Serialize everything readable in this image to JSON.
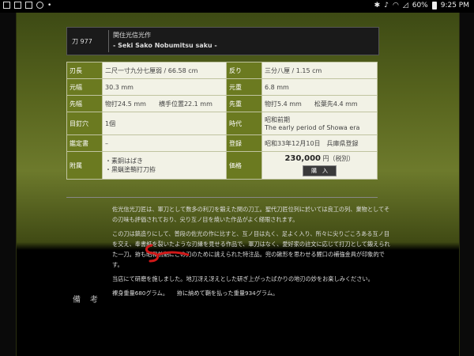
{
  "status": {
    "battery": "60%",
    "time": "9:25 PM"
  },
  "header": {
    "item_no": "刀 977",
    "title_jp": "関住光信光作",
    "title_en": "- Seki Sako Nobumitsu saku -"
  },
  "spec": [
    {
      "k1": "刃長",
      "v1": "二尺一寸九分七厘弱 / 66.58 cm",
      "k2": "反り",
      "v2": "三分八厘 / 1.15 cm"
    },
    {
      "k1": "元幅",
      "v1": "30.3 mm",
      "k2": "元重",
      "v2": "6.8 mm"
    },
    {
      "k1": "先幅",
      "v1": "物打24.5 mm　　横手位置22.1 mm",
      "k2": "先重",
      "v2": "物打5.4 mm　　松葉先4.4 mm"
    },
    {
      "k1": "目釘穴",
      "v1": "1個",
      "k2": "時代",
      "v2": "昭和前期",
      "v2b": "The early period of Showa era"
    },
    {
      "k1": "鑑定書",
      "v1": "–",
      "k2": "登録",
      "v2": "昭和33年12月10日　兵庫県登録"
    }
  ],
  "accessories": {
    "key": "附属",
    "items": [
      "・素銅はばき",
      "・黒蝋塗鞘打刀拵"
    ],
    "price_key": "価格",
    "price": "230,000",
    "price_unit": "円（税別）",
    "buy_label": "購　入"
  },
  "notes_label": "備考",
  "notes": [
    "佐光信光刀匠は、軍刀として数多の利刀を鍛えた関の刀工。聖代刀匠位列に於いては良工の列、業物としてその刃味も評価されており、尖り互ノ目を焼いた作品がよく経眼されます。",
    "この刀は鎬造りにして、普段の佐光の作に比すと、互ノ目は丸く、足よく入り、所々に尖りごころある互ノ目を交え、奉書紙を裂いたような刃縁を見せる作品で、軍刀はなく、愛好家の註文に応じて打刀として鍛えられた一刀。拵も昭和前期にこの刀のために誂えられた特注品。兜の鍬形を思わせる鯉口の補強金具が印象的です。",
    "当店にて研磨を施しました。地刀冴え冴えとした研ぎ上がったばかりの地刃の妙をお楽しみください。",
    "裸身重量680グラム。　　拵に納めて鞘を払った重量934グラム。"
  ]
}
